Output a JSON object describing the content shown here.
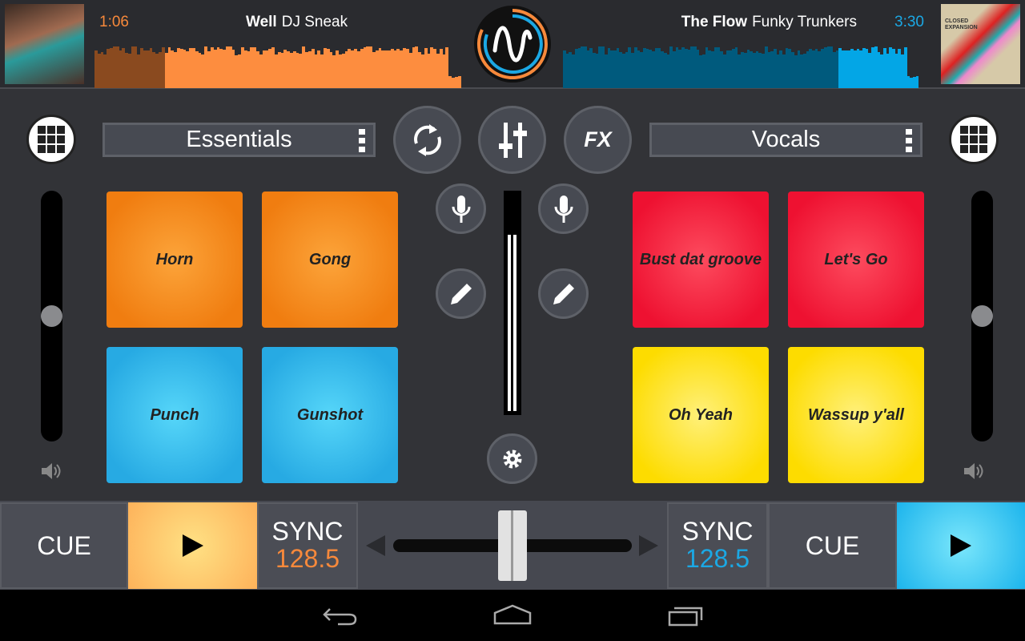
{
  "deck_left": {
    "time": "1:06",
    "title": "Well",
    "artist": "DJ Sneak",
    "color": "#f7893b",
    "progress": 0.19,
    "selector": "Essentials",
    "bpm": "128.5",
    "sync_label": "SYNC",
    "cue_label": "CUE",
    "pads": [
      {
        "label": "Horn",
        "color": "orange"
      },
      {
        "label": "Gong",
        "color": "orange"
      },
      {
        "label": "Punch",
        "color": "blue"
      },
      {
        "label": "Gunshot",
        "color": "blue"
      }
    ],
    "volume": 0.5
  },
  "deck_right": {
    "time": "3:30",
    "title": "The Flow",
    "artist": "Funky Trunkers",
    "color": "#1ba8e4",
    "progress": 0.77,
    "selector": "Vocals",
    "bpm": "128.5",
    "sync_label": "SYNC",
    "cue_label": "CUE",
    "album_text": "CLOSED EXPANSION",
    "pads": [
      {
        "label": "Bust dat groove",
        "color": "red"
      },
      {
        "label": "Let's Go",
        "color": "red"
      },
      {
        "label": "Oh Yeah",
        "color": "yellow"
      },
      {
        "label": "Wassup y'all",
        "color": "yellow"
      }
    ],
    "volume": 0.5
  },
  "center": {
    "fx_label": "FX",
    "crossfader": 0.5
  },
  "nav": {
    "icons": [
      "back-icon",
      "home-icon",
      "recents-icon"
    ]
  }
}
